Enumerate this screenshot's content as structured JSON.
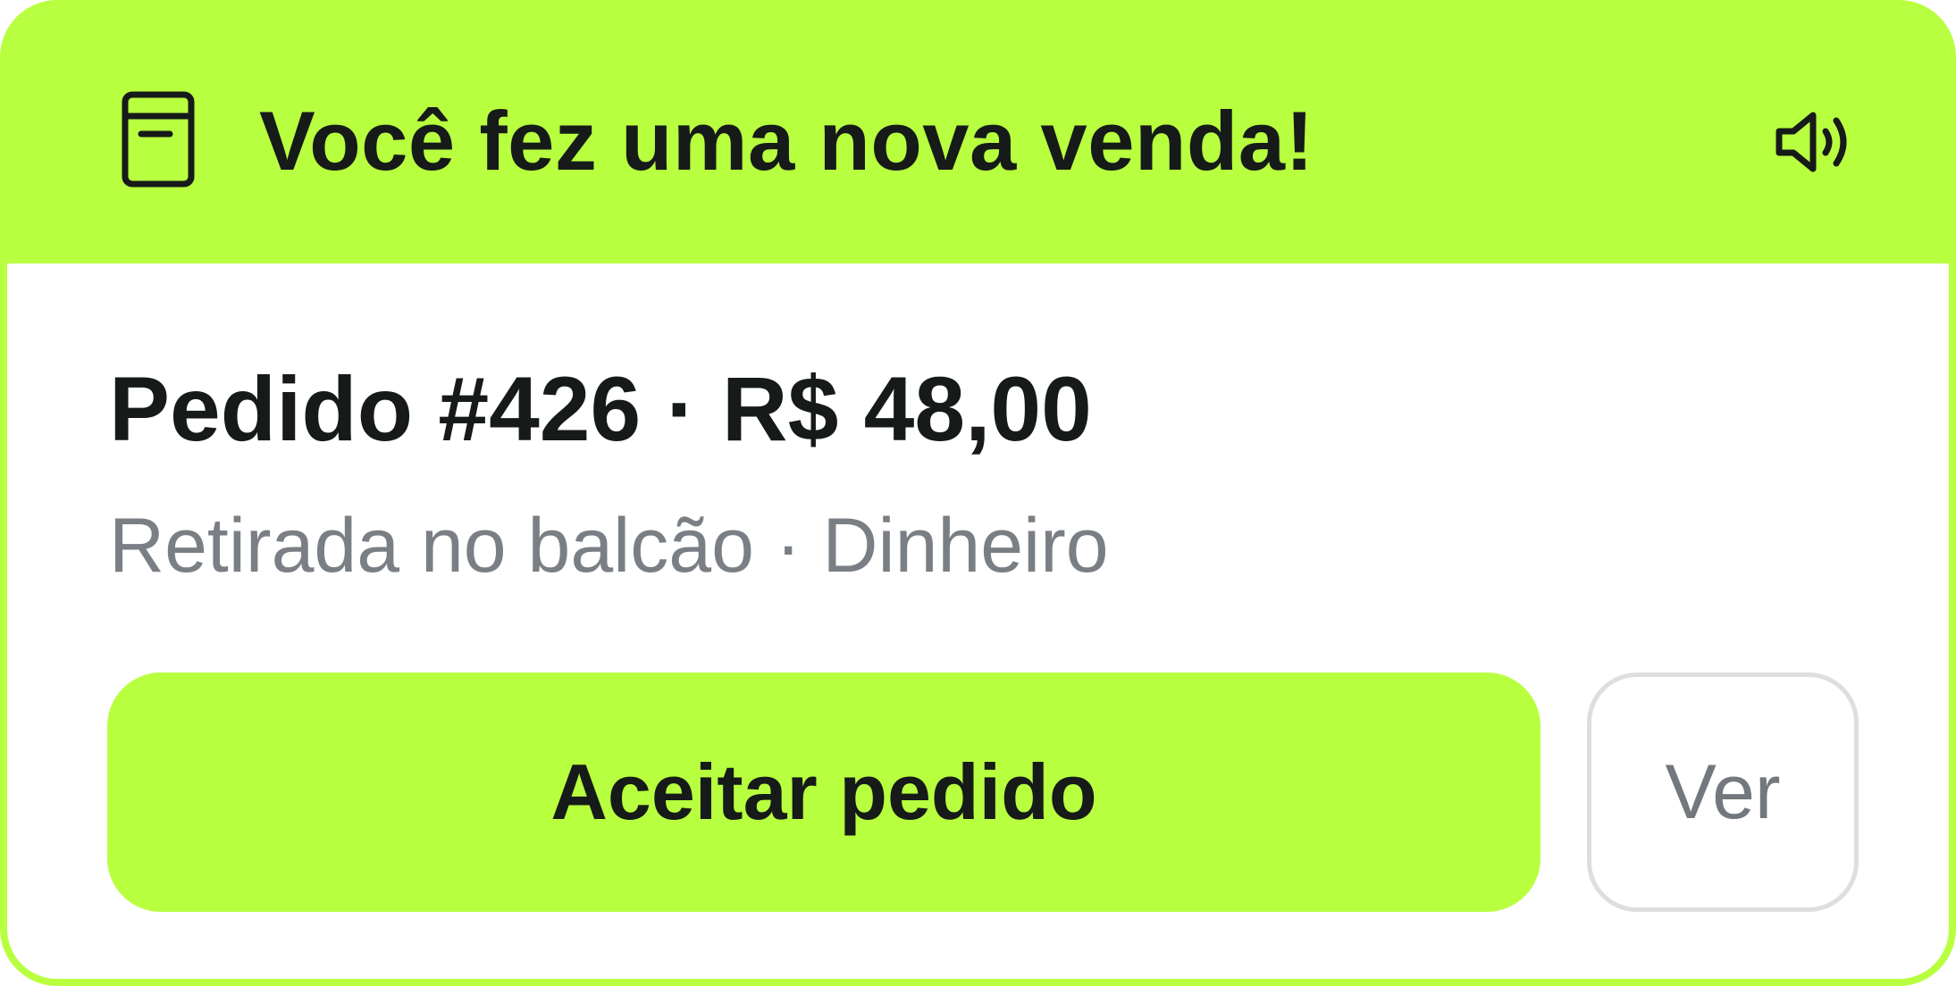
{
  "notification": {
    "title": "Você fez uma nova venda!",
    "icons": {
      "header": "receipt-box-icon",
      "sound": "speaker-volume-icon"
    },
    "order": {
      "title": "Pedido #426 · R$ 48,00",
      "subtitle": "Retirada no balcão · Dinheiro"
    },
    "actions": {
      "accept_label": "Aceitar pedido",
      "view_label": "Ver"
    },
    "colors": {
      "accent": "#b8ff3f",
      "text_primary": "#161a18",
      "text_secondary": "#7a7f85",
      "border_neutral": "#dedede"
    }
  }
}
